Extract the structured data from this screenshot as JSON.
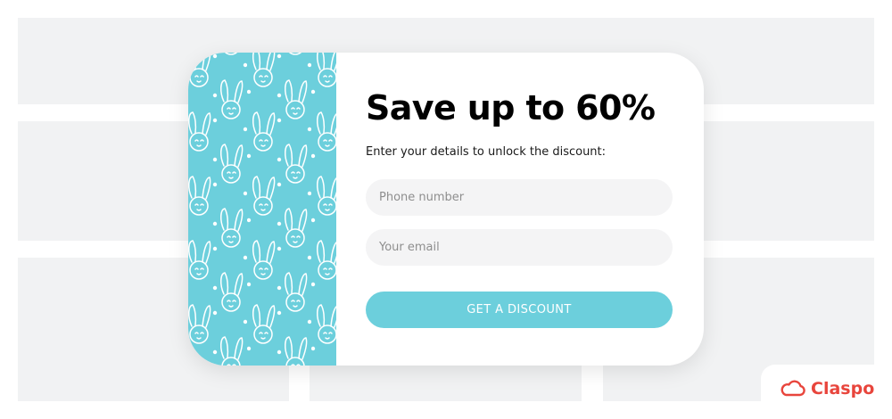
{
  "popup": {
    "headline": "Save up to 60%",
    "subtext": "Enter your details to unlock the discount:",
    "phone_placeholder": "Phone number",
    "email_placeholder": "Your email",
    "cta_label": "GET A DISCOUNT",
    "pattern_icon": "bunny-pattern",
    "accent_color": "#6ccfdc"
  },
  "brand": {
    "name": "Claspo",
    "icon": "cloud-icon",
    "color": "#e8453c"
  }
}
